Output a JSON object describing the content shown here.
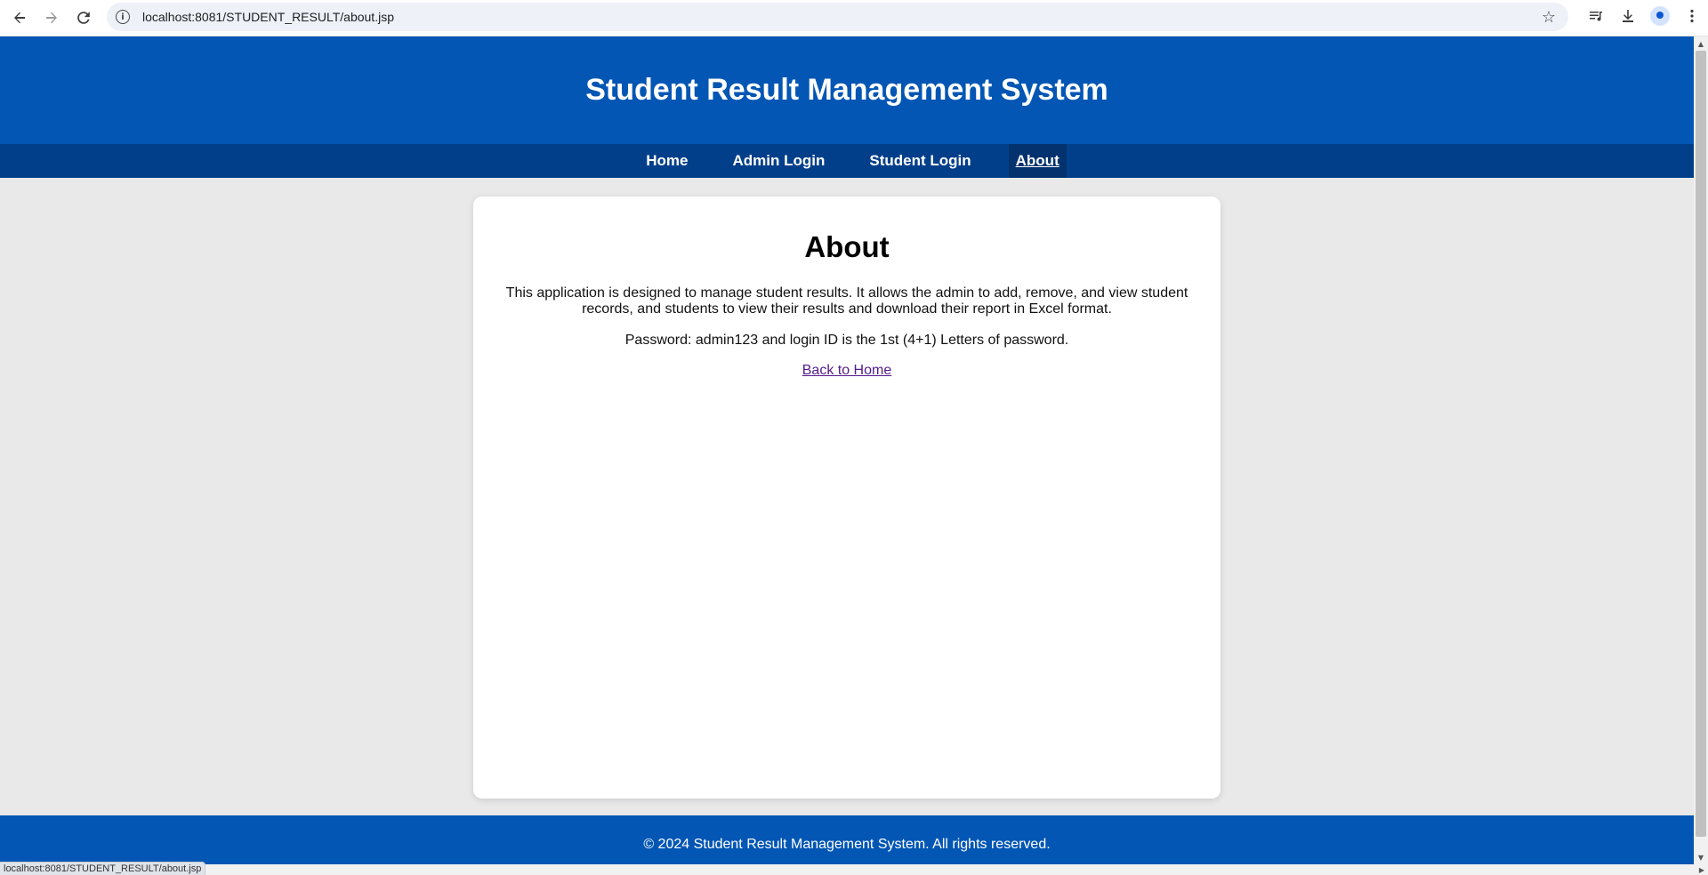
{
  "browser": {
    "url": "localhost:8081/STUDENT_RESULT/about.jsp",
    "status_url": "localhost:8081/STUDENT_RESULT/about.jsp"
  },
  "header": {
    "title": "Student Result Management System"
  },
  "nav": {
    "items": [
      {
        "label": "Home"
      },
      {
        "label": "Admin Login"
      },
      {
        "label": "Student Login"
      },
      {
        "label": "About"
      }
    ],
    "active": "About"
  },
  "content": {
    "heading": "About",
    "description": "This application is designed to manage student results. It allows the admin to add, remove, and view student records, and students to view their results and download their report in Excel format.",
    "password_note": "Password: admin123 and login ID is the 1st (4+1) Letters of password.",
    "back_link": "Back to Home"
  },
  "footer": {
    "text": "© 2024 Student Result Management System. All rights reserved."
  },
  "icons": {
    "back": "arrow-left-icon",
    "forward": "arrow-right-icon",
    "reload": "reload-icon",
    "site_info": "info-icon",
    "bookmark": "star-icon",
    "media": "media-control-icon",
    "download": "download-icon",
    "profile": "profile-icon",
    "menu": "kebab-menu-icon"
  },
  "colors": {
    "header_bg": "#0356b4",
    "nav_bg": "#023f8a",
    "page_bg": "#e9e9ea",
    "link_visited": "#551a8b"
  }
}
